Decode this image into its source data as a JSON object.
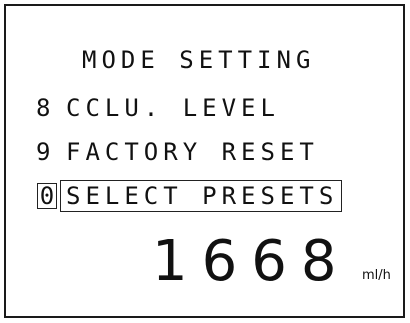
{
  "screen": {
    "title": "MODE SETTING",
    "menu": [
      {
        "number": "8",
        "label": "CCLU. LEVEL",
        "selected": false
      },
      {
        "number": "9",
        "label": "FACTORY RESET",
        "selected": false
      },
      {
        "number": "0",
        "label": "SELECT PRESETS",
        "selected": true
      }
    ],
    "readout": {
      "value": "1668",
      "unit": "ml/h"
    }
  }
}
